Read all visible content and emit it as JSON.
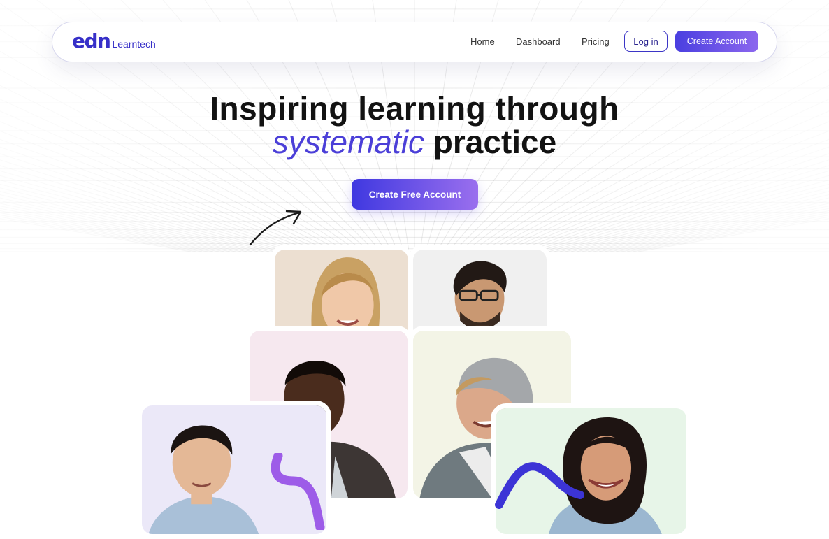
{
  "brand": {
    "logo_mark": "edn",
    "logo_text": "Learntech",
    "color": "#3730c8"
  },
  "nav": {
    "links": [
      "Home",
      "Dashboard",
      "Pricing"
    ],
    "login_label": "Log in",
    "create_label": "Create Account"
  },
  "hero": {
    "line1": "Inspiring learning through",
    "accent": "systematic",
    "line2_rest": "practice",
    "cta_label": "Create Free Account",
    "accent_color": "#4b3fd8"
  },
  "photos": [
    {
      "name": "woman-blonde-photo",
      "bg": "#ecdfd1"
    },
    {
      "name": "man-glasses-photo",
      "bg": "#f0f0f0"
    },
    {
      "name": "young-man-photo",
      "bg": "#f6e8ef"
    },
    {
      "name": "man-beanie-photo",
      "bg": "#f3f4e6"
    },
    {
      "name": "asian-man-photo",
      "bg": "#ebe8f8"
    },
    {
      "name": "woman-curly-photo",
      "bg": "#e7f5e8"
    }
  ]
}
